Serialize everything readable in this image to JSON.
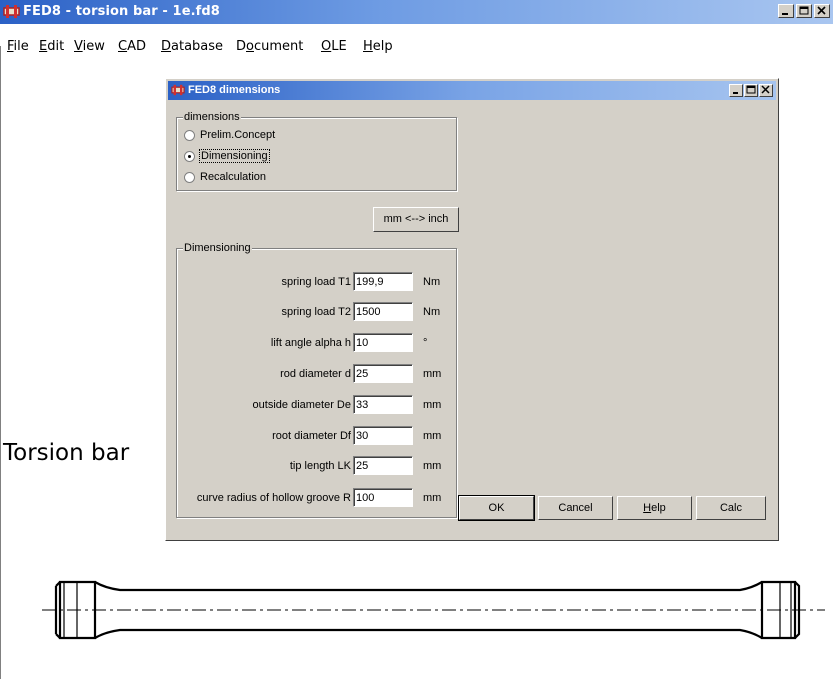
{
  "window": {
    "title": "FED8 - torsion bar  -  1e.fd8",
    "controls": [
      "_",
      "□",
      "×"
    ]
  },
  "menu": [
    {
      "label": "File",
      "u": "F",
      "rest": "ile"
    },
    {
      "label": "Edit",
      "u": "E",
      "rest": "dit"
    },
    {
      "label": "View",
      "u": "V",
      "rest": "iew"
    },
    {
      "label": "CAD",
      "u": "C",
      "rest": "AD"
    },
    {
      "label": "Database",
      "u": "D",
      "rest": "atabase"
    },
    {
      "label": "Document",
      "pre": "D",
      "u": "o",
      "rest": "cument"
    },
    {
      "label": "OLE",
      "u": "O",
      "rest": "LE"
    },
    {
      "label": "Help",
      "u": "H",
      "rest": "elp"
    }
  ],
  "drawing": {
    "label": "Torsion bar"
  },
  "dialog": {
    "title": "FED8 dimensions",
    "controls": [
      "_",
      "□",
      "×"
    ],
    "mode_group": {
      "label": "dimensions",
      "options": [
        "Prelim.Concept",
        "Dimensioning",
        "Recalculation"
      ],
      "selected": "Dimensioning"
    },
    "unit_toggle_label": "mm <--> inch",
    "dim_group": {
      "label": "Dimensioning",
      "fields": [
        {
          "label": "spring load T1",
          "value": "199,9",
          "unit": "Nm"
        },
        {
          "label": "spring load T2",
          "value": "1500",
          "unit": "Nm"
        },
        {
          "label": "lift angle alpha h",
          "value": "10",
          "unit": "°"
        },
        {
          "label": "rod diameter d",
          "value": "25",
          "unit": "mm"
        },
        {
          "label": "outside diameter De",
          "value": "33",
          "unit": "mm"
        },
        {
          "label": "root diameter Df",
          "value": "30",
          "unit": "mm"
        },
        {
          "label": "tip length LK",
          "value": "25",
          "unit": "mm"
        },
        {
          "label": "curve radius of hollow groove R",
          "value": "100",
          "unit": "mm"
        }
      ]
    },
    "buttons": {
      "ok": "OK",
      "cancel": "Cancel",
      "help_u": "H",
      "help_rest": "elp",
      "calc": "Calc"
    }
  }
}
